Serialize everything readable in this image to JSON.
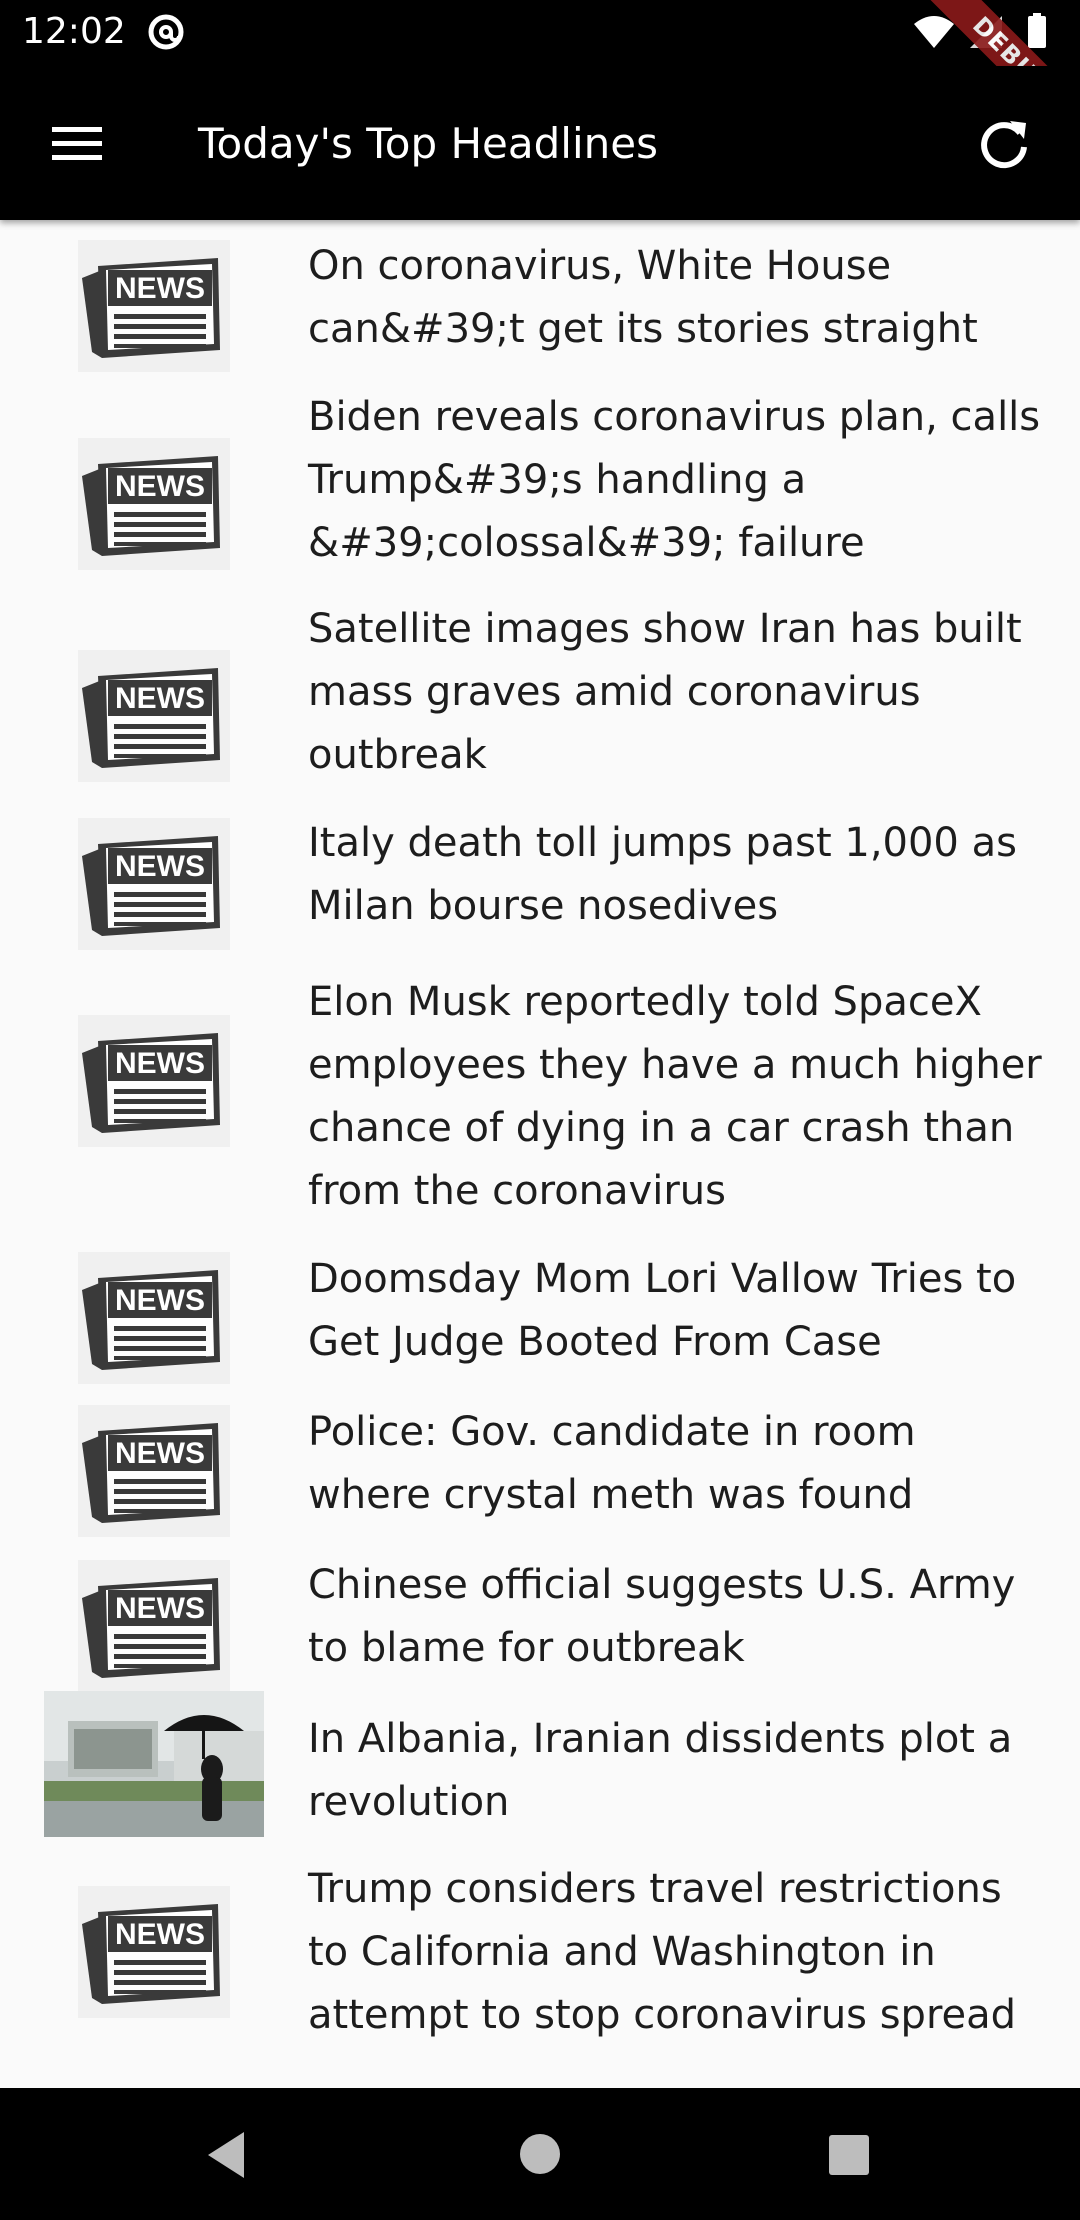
{
  "status_bar": {
    "time": "12:02",
    "icons": [
      "at-sign-icon",
      "wifi-icon",
      "signal-icon",
      "battery-icon"
    ],
    "debug_label": "DEBUG"
  },
  "app_bar": {
    "title": "Today's Top Headlines",
    "menu_icon": "hamburger-menu-icon",
    "refresh_icon": "refresh-icon",
    "background": "#000000"
  },
  "headlines": [
    {
      "title": "On coronavirus, White House can&#39;t get its stories straight",
      "image": "news-icon"
    },
    {
      "title": "Biden reveals coronavirus plan, calls Trump&#39;s handling a &#39;colossal&#39; failure",
      "image": "news-icon"
    },
    {
      "title": "Satellite images show Iran has built mass graves amid coronavirus outbreak",
      "image": "news-icon"
    },
    {
      "title": "Italy death toll jumps past 1,000 as Milan bourse nosedives",
      "image": "news-icon"
    },
    {
      "title": "Elon Musk reportedly told SpaceX employees they have a much higher chance of dying in a car crash than from the coronavirus",
      "image": "news-icon"
    },
    {
      "title": "Doomsday Mom Lori Vallow Tries to Get Judge Booted From Case",
      "image": "news-icon"
    },
    {
      "title": "Police: Gov. candidate in room where crystal meth was found",
      "image": "news-icon"
    },
    {
      "title": "Chinese official suggests U.S. Army to blame for outbreak",
      "image": "news-icon"
    },
    {
      "title": "In Albania, Iranian dissidents plot a revolution",
      "image": "photo-umbrella"
    },
    {
      "title": "Trump considers travel restrictions to California and Washington in attempt to stop coronavirus spread",
      "image": "news-icon"
    }
  ],
  "nav_bar": {
    "buttons": [
      "back-icon",
      "home-icon",
      "recents-icon"
    ]
  }
}
